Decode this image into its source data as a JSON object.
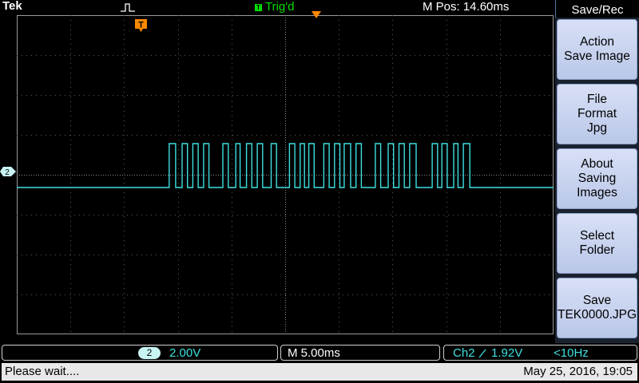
{
  "top": {
    "brand": "Tek",
    "trigger_badge": "T",
    "trigger_status": "Trig'd",
    "horizontal_position": "M Pos: 14.60ms",
    "colors": {
      "trigger_status": "#00e000",
      "trigger_marker": "#ff8800"
    },
    "icons": [
      "pulse-trigger-icon",
      "trigger-position-marker-icon"
    ]
  },
  "scope": {
    "channel_marker": "2",
    "trigger_marker": "T",
    "trace_color": "#3ee0e0",
    "grid": {
      "h_divisions": 10,
      "v_divisions": 8
    },
    "signal": {
      "baseline_level": 0,
      "high_level": 2.2,
      "units_per_division": 2.0,
      "bursts_ms": [
        [
          -10.8,
          -10.2,
          -9.6,
          -9.1,
          -8.6,
          -8.1,
          -7.6,
          -7.1
        ],
        [
          -5.8,
          -5.3,
          -4.6,
          -4.2,
          -3.6,
          -3.1,
          -2.6,
          -2.1
        ],
        [
          -1.3,
          -0.8,
          0.4,
          0.9,
          1.4,
          1.8,
          2.2,
          2.7
        ],
        [
          3.6,
          4.1,
          4.6,
          5.1,
          5.5,
          6.1,
          6.6,
          7.1
        ],
        [
          8.4,
          8.9,
          9.6,
          10.1,
          10.6,
          11.1,
          11.6,
          12.2
        ],
        [
          13.7,
          14.2,
          14.6,
          15.1,
          15.7,
          16.1,
          16.6,
          17.2
        ]
      ]
    }
  },
  "menu": {
    "title": "Save/Rec",
    "buttons": [
      {
        "lines": [
          "Action",
          "Save Image"
        ]
      },
      {
        "lines": [
          "File",
          "Format",
          "Jpg"
        ]
      },
      {
        "lines": [
          "About",
          "Saving",
          "Images"
        ]
      },
      {
        "lines": [
          "Select",
          "Folder"
        ]
      },
      {
        "lines": [
          "Save",
          "TEK0000.JPG"
        ]
      }
    ]
  },
  "status": {
    "channel_badge": "2",
    "channel_scale": "2.00V",
    "time_scale": "M 5.00ms",
    "trigger_source": "Ch2",
    "trigger_level": "1.92V",
    "trigger_freq": "<10Hz",
    "message": "Please wait....",
    "datetime": "May 25, 2016, 19:05"
  }
}
